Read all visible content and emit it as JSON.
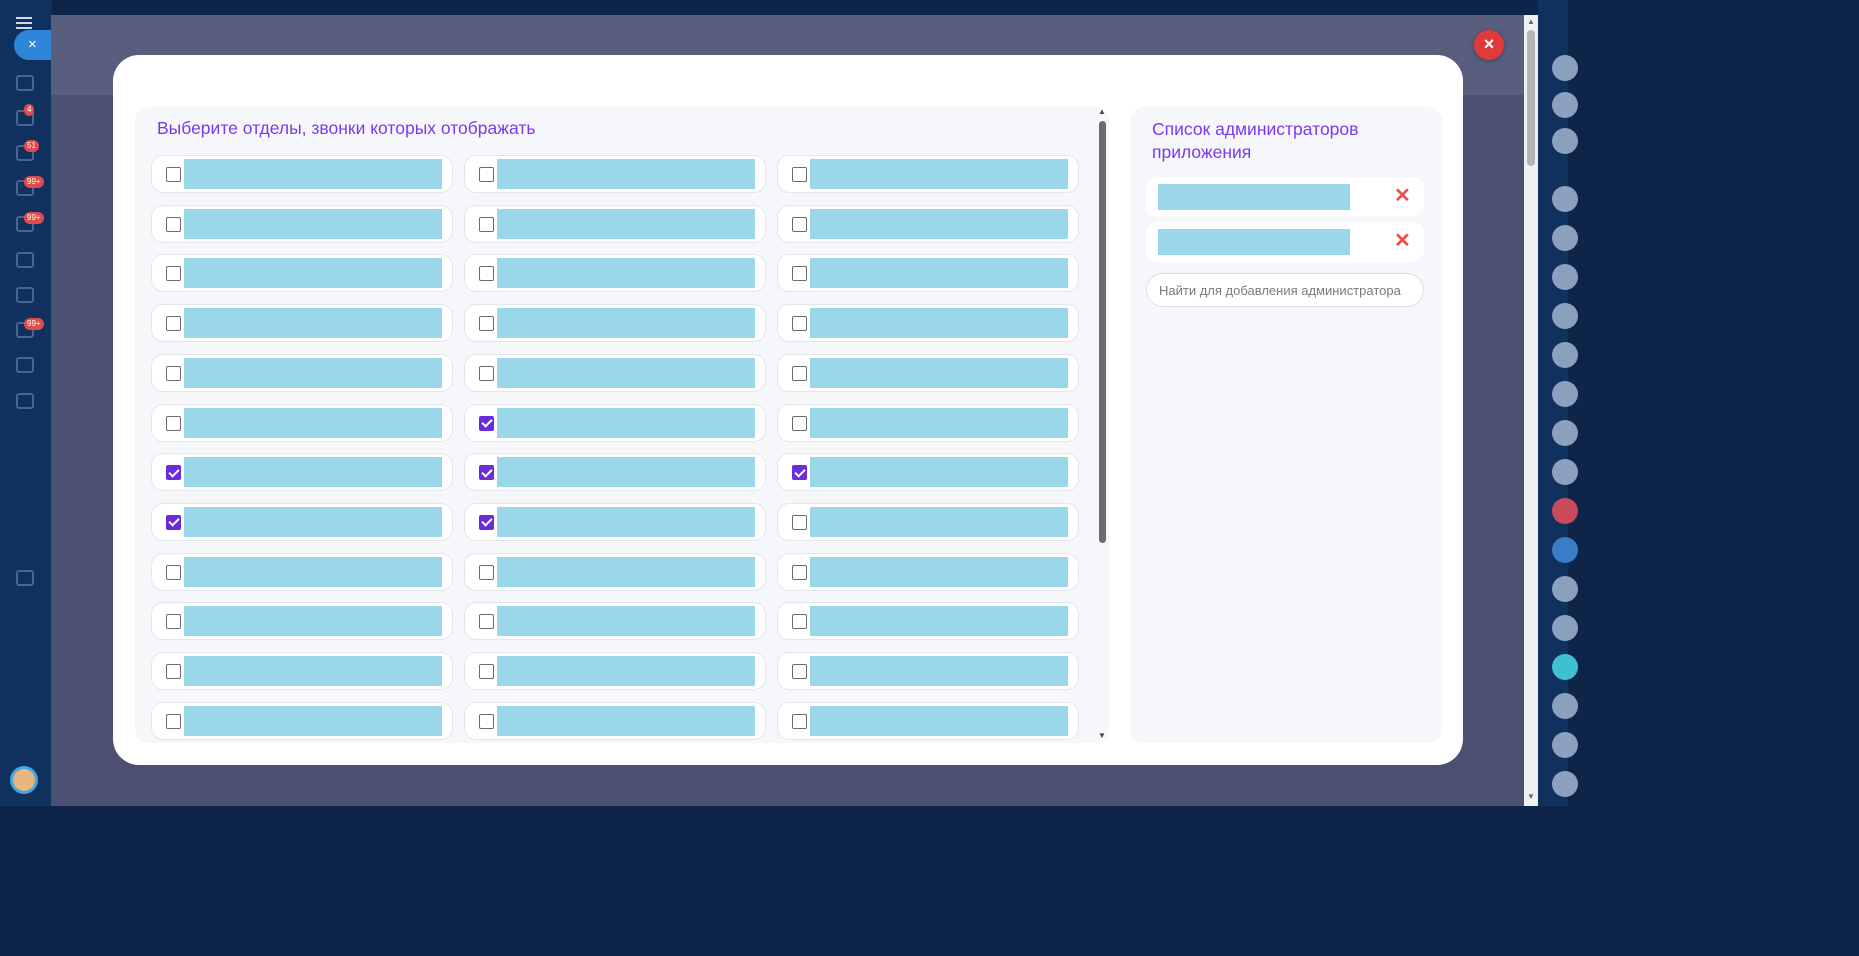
{
  "background_app": {
    "close_label": "×",
    "badges": [
      "4",
      "51",
      "99+",
      "99+",
      "99+"
    ]
  },
  "modal": {
    "close_label": "×",
    "departments_title": "Выберите отделы, звонки которых отображать",
    "departments": [
      {
        "name": "",
        "checked": false
      },
      {
        "name": "",
        "checked": false
      },
      {
        "name": "",
        "checked": false
      },
      {
        "name": "",
        "checked": false
      },
      {
        "name": "",
        "checked": false
      },
      {
        "name": "",
        "checked": false
      },
      {
        "name": "",
        "checked": false
      },
      {
        "name": "",
        "checked": false
      },
      {
        "name": "",
        "checked": false
      },
      {
        "name": "",
        "checked": false
      },
      {
        "name": "",
        "checked": false
      },
      {
        "name": "",
        "checked": false
      },
      {
        "name": "",
        "checked": false
      },
      {
        "name": "",
        "checked": false
      },
      {
        "name": "",
        "checked": false
      },
      {
        "name": "",
        "checked": false
      },
      {
        "name": "",
        "checked": true
      },
      {
        "name": "",
        "checked": false
      },
      {
        "name": "",
        "checked": true
      },
      {
        "name": "",
        "checked": true
      },
      {
        "name": "",
        "checked": true
      },
      {
        "name": "",
        "checked": true
      },
      {
        "name": "",
        "checked": true
      },
      {
        "name": "",
        "checked": false
      },
      {
        "name": "",
        "checked": false
      },
      {
        "name": "",
        "checked": false
      },
      {
        "name": "",
        "checked": false
      },
      {
        "name": "",
        "checked": false
      },
      {
        "name": "",
        "checked": false
      },
      {
        "name": "",
        "checked": false
      },
      {
        "name": "",
        "checked": false
      },
      {
        "name": "",
        "checked": false
      },
      {
        "name": "",
        "checked": false
      },
      {
        "name": "",
        "checked": false
      },
      {
        "name": "",
        "checked": false
      },
      {
        "name": "",
        "checked": false
      }
    ],
    "admins_title": "Список администраторов приложения",
    "admins": [
      {
        "name": "",
        "remove_label": "✕"
      },
      {
        "name": "",
        "remove_label": "✕"
      }
    ],
    "admin_search": {
      "value": "",
      "placeholder": "Найти для добавления администратора"
    },
    "accent_color": "#7c3aed",
    "checkbox_color": "#6c2bd9",
    "redacted_color": "#9ad8e9",
    "remove_color": "#ee4d4d"
  }
}
